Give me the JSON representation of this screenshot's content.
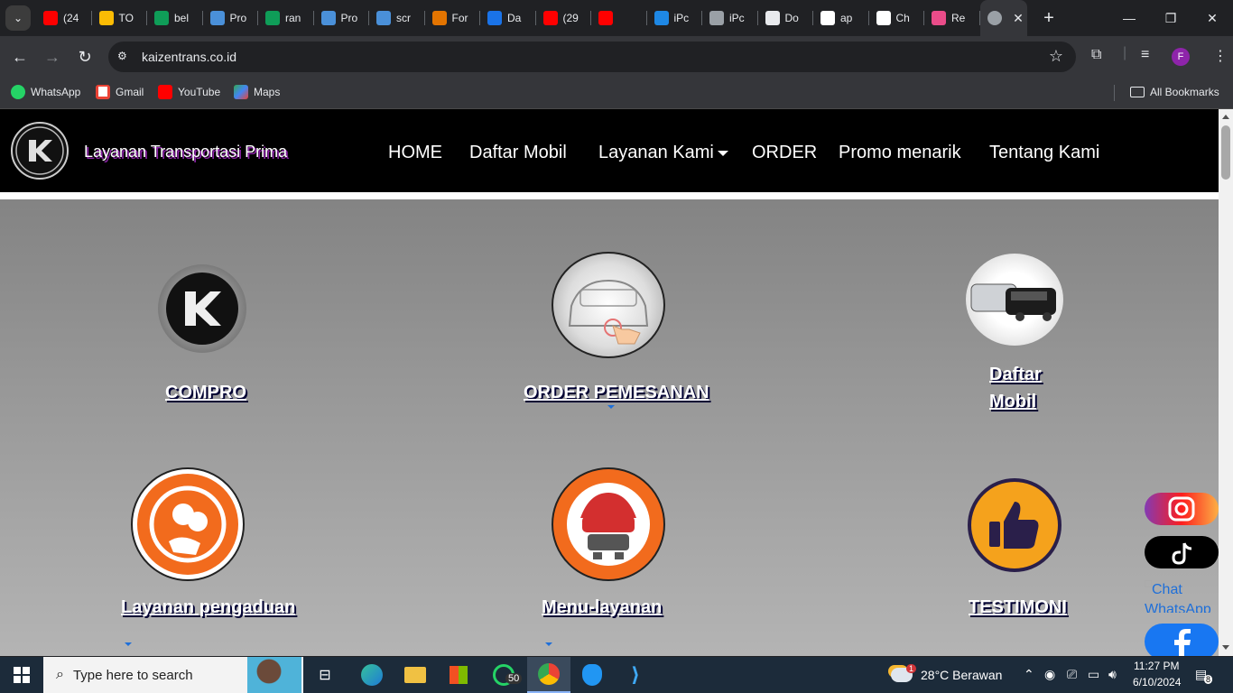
{
  "browser": {
    "tabs": [
      {
        "title": "(24",
        "icon": "youtube-icon",
        "color": "#ff0000"
      },
      {
        "title": "TO",
        "icon": "google-drive-icon",
        "color": "#fbbc04"
      },
      {
        "title": "bel",
        "icon": "sheets-icon",
        "color": "#0f9d58"
      },
      {
        "title": "Pro",
        "icon": "prezi-icon",
        "color": "#4a90d9"
      },
      {
        "title": "ran",
        "icon": "sheets-icon",
        "color": "#0f9d58"
      },
      {
        "title": "Pro",
        "icon": "prezi-icon",
        "color": "#4a90d9"
      },
      {
        "title": "scr",
        "icon": "prezi-icon",
        "color": "#4a90d9"
      },
      {
        "title": "For",
        "icon": "forms-icon",
        "color": "#e37400"
      },
      {
        "title": "Da",
        "icon": "dashboard-icon",
        "color": "#1a73e8"
      },
      {
        "title": "(29",
        "icon": "youtube-icon",
        "color": "#ff0000"
      },
      {
        "title": "",
        "icon": "youtube-audio-icon",
        "color": "#ff0000"
      },
      {
        "title": "iPc",
        "icon": "ipc-icon",
        "color": "#1e88e5"
      },
      {
        "title": "iPc",
        "icon": "globe-icon",
        "color": "#9aa0a6"
      },
      {
        "title": "Do",
        "icon": "download-icon",
        "color": "#e8eaed"
      },
      {
        "title": "ap",
        "icon": "google-icon",
        "color": "#ffffff"
      },
      {
        "title": "Ch",
        "icon": "chatgpt-icon",
        "color": "#ffffff"
      },
      {
        "title": "Re",
        "icon": "dribbble-icon",
        "color": "#ea4c89"
      }
    ],
    "url": "kaizentrans.co.id",
    "bookmarks": [
      {
        "label": "WhatsApp",
        "color": "#25d366"
      },
      {
        "label": "Gmail",
        "color": "#ea4335"
      },
      {
        "label": "YouTube",
        "color": "#ff0000"
      },
      {
        "label": "Maps",
        "color": "#34a853"
      }
    ],
    "all_bookmarks": "All Bookmarks",
    "profile_initial": "F"
  },
  "site": {
    "brand": "Layanan Transportasi Prima",
    "menu": [
      "HOME",
      "Daftar Mobil",
      "Layanan Kami",
      "ORDER",
      "Promo menarik",
      "Tentang Kami"
    ],
    "cards": [
      {
        "label": "COMPRO"
      },
      {
        "label": "ORDER PEMESANAN"
      },
      {
        "label_line1": "Daftar",
        "label_line2": "Mobil"
      },
      {
        "label": "Layanan pengaduan"
      },
      {
        "label": "Menu-layanan"
      },
      {
        "label": "TESTIMONI"
      }
    ],
    "chat_alt_line1": "Chat",
    "chat_alt_line2": "WhatsApp"
  },
  "taskbar": {
    "search_placeholder": "Type here to search",
    "whatsapp_badge": "50",
    "weather_badge": "1",
    "weather": "28°C  Berawan",
    "time": "11:27 PM",
    "date": "6/10/2024",
    "notification_count": "8"
  }
}
